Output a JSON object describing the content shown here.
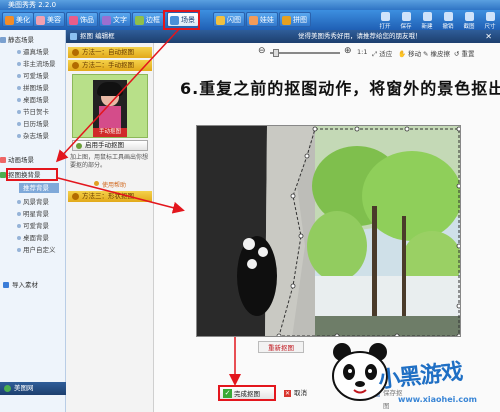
{
  "window": {
    "title": "美图秀秀 2.2.0"
  },
  "toolbar": {
    "tabs": [
      {
        "label": "美化"
      },
      {
        "label": "美容"
      },
      {
        "label": "饰品"
      },
      {
        "label": "文字"
      },
      {
        "label": "边框"
      },
      {
        "label": "场景"
      },
      {
        "label": "闪图"
      },
      {
        "label": "娃娃"
      },
      {
        "label": "拼图"
      }
    ],
    "right_tools": [
      {
        "label": "打开"
      },
      {
        "label": "保存"
      },
      {
        "label": "新建"
      },
      {
        "label": "撤销"
      },
      {
        "label": "截图"
      },
      {
        "label": "尺寸"
      }
    ]
  },
  "sidebar": {
    "items": [
      {
        "label": "静态场景"
      },
      {
        "label": "逼真场景"
      },
      {
        "label": "非主流场景"
      },
      {
        "label": "可爱场景"
      },
      {
        "label": "拼图场景"
      },
      {
        "label": "桌面场景"
      },
      {
        "label": "节日贺卡"
      },
      {
        "label": "日历场景"
      },
      {
        "label": "杂志场景"
      }
    ],
    "animated": {
      "label": "动画场景"
    },
    "cutout": {
      "label": "抠图换背景"
    },
    "cutout_sub": [
      {
        "label": "推荐背景"
      },
      {
        "label": "风景背景"
      },
      {
        "label": "明星背景"
      },
      {
        "label": "可爱背景"
      },
      {
        "label": "桌面背景"
      },
      {
        "label": "用户自定义"
      }
    ],
    "import": {
      "label": "导入素材"
    },
    "footer": {
      "label": "美图网"
    }
  },
  "panel": {
    "title": "抠图 编辑框",
    "tip": "觉得美图秀秀好用，请推荐给您的朋友哦！"
  },
  "method_panel": {
    "method1": "方法一：自动抠图",
    "method2": "方法二：手动抠图",
    "thumb_caption": "手动抠图",
    "enable_button": "启用手动抠图",
    "hint_text": "加上图，用鼠标工具画出你想要抠的部分。",
    "help_link": "使用帮助",
    "method3": "方法三：形状抠图"
  },
  "controls": {
    "zoom_ratio": "1:1",
    "fit": "适应",
    "hand": "移动",
    "eraser": "橡皮擦",
    "reset": "重置"
  },
  "canvas": {
    "instruction": "6.重复之前的抠图动作，将窗外的景色抠出",
    "redo_button": "重新抠图",
    "complete_button": "完成抠图",
    "cancel_button": "取消",
    "save_button": "保存抠图"
  },
  "watermark": {
    "logo_text": "小黑游戏",
    "url": "www.xiaohei.com"
  }
}
